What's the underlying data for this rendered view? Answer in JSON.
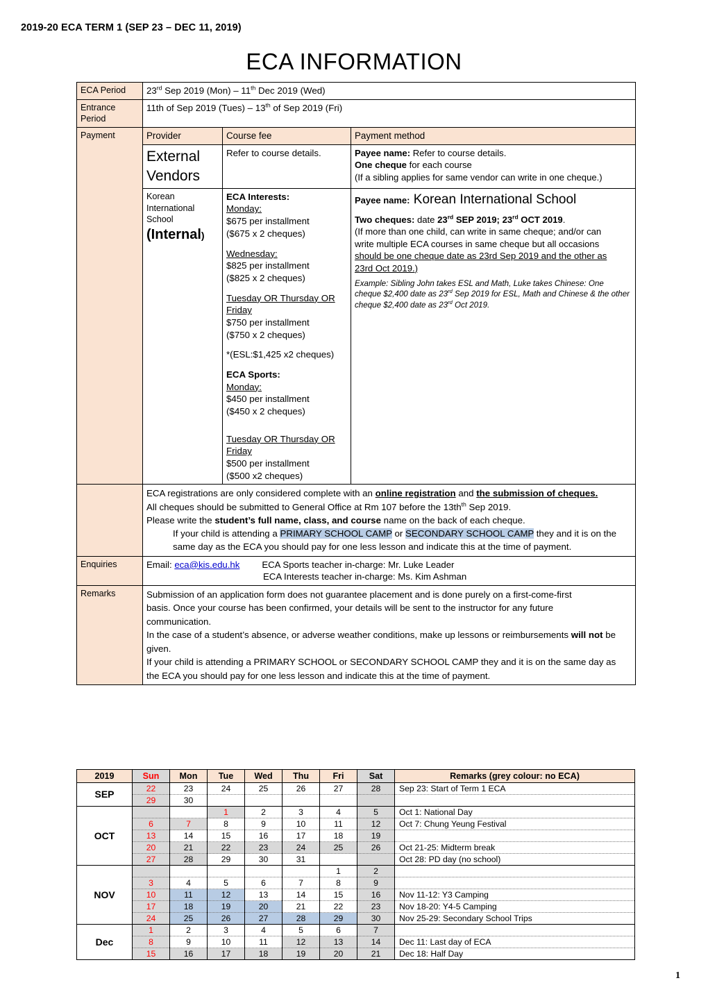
{
  "header": {
    "doc_header": "2019-20 ECA   TERM 1   (SEP 23 – DEC 11, 2019)",
    "title": "ECA  INFORMATION",
    "page_number": "1"
  },
  "info": {
    "eca_period_label": "ECA Period",
    "eca_period_value_pre": "23",
    "eca_period_value_sup1": "rd",
    "eca_period_value_mid": " Sep 2019 (Mon) – 11",
    "eca_period_value_sup2": "th",
    "eca_period_value_post": " Dec 2019 (Wed)",
    "entrance_label": "Entrance Period",
    "entrance_value_pre": "11th of Sep 2019 (Tues) – 13",
    "entrance_value_sup": "th",
    "entrance_value_post": " of Sep 2019 (Fri)",
    "payment_label": "Payment",
    "col_provider": "Provider",
    "col_course_fee": "Course fee",
    "col_payment_method": "Payment method"
  },
  "external": {
    "provider": "External Vendors",
    "provider_line1": "External",
    "provider_line2": "Vendors",
    "course_fee": "Refer to course details.",
    "payee_label": "Payee name:",
    "payee_value": " Refer to course details.",
    "one_cheque_bold": "One cheque",
    "one_cheque_rest": " for each course",
    "sibling_note": "(If a sibling applies for same vendor can write in one cheque.)"
  },
  "internal": {
    "provider_line1": "Korean",
    "provider_line2": "International",
    "provider_line3": "School",
    "provider_internal": "Internal",
    "fees": {
      "interests_title": "ECA Interests:",
      "interests": [
        {
          "day": "Monday:",
          "line1": "$675 per installment",
          "line2": "($675 x 2 cheques)"
        },
        {
          "day": "Wednesday:",
          "line1": "$825 per installment",
          "line2": "($825 x 2 cheques)"
        },
        {
          "day": "Tuesday OR Thursday OR Friday",
          "line1": "$750 per installment",
          "line2": "($750 x 2 cheques)"
        }
      ],
      "esl_note": "*(ESL:$1,425 x2 cheques)",
      "sports_title": "ECA Sports:",
      "sports": [
        {
          "day": "Monday:",
          "line1": "$450 per installment",
          "line2": "($450 x 2 cheques)"
        },
        {
          "day": "Tuesday OR Thursday OR Friday",
          "line1": "$500 per installment",
          "line2": "($500 x2 cheques)"
        }
      ]
    },
    "payment": {
      "payee_label": "Payee name:",
      "payee_value": " Korean International School",
      "two_cheques_label": "Two cheques:",
      "two_cheques_mid": " date ",
      "date1_pre": "23",
      "date1_sup": "rd",
      "date1_post": " SEP 2019; ",
      "date2_pre": "23",
      "date2_sup": "rd",
      "date2_post": " OCT 2019",
      "period": ".",
      "paren_line1": "(If more than one child, can write in same cheque; and/or can",
      "paren_line2": "write multiple ECA courses in same cheque but all occasions",
      "underlined1": "should be one cheque date as 23rd Sep 2019 and the other as",
      "underlined2": "23rd Oct 2019.)",
      "example_pre": "Example: Sibling John takes ESL and Math, Luke takes Chinese: One cheque $2,400 date as 23",
      "example_sup1": "rd",
      "example_mid": " Sep 2019 for ESL, Math and Chinese & the other cheque $2,400 date as 23",
      "example_sup2": "rd",
      "example_post": " Oct 2019."
    }
  },
  "registration_note": {
    "line1_a": "ECA registrations are only considered complete with an ",
    "line1_b": "online registration",
    "line1_c": " and ",
    "line1_d": "the submission of cheques.",
    "line2_a": "All cheques should be submitted to General Office at Rm 107 before the 13th",
    "line2_sup": "th",
    "line2_b": " Sep 2019.",
    "line3_a": "Please write the ",
    "line3_b": "student’s full name, class, and course",
    "line3_c": " name on the back of each cheque.",
    "line4_a": "If your child is attending a ",
    "line4_hl1": "PRIMARY SCHOOL CAMP",
    "line4_b": " or ",
    "line4_hl2": "SECONDARY SCHOOL CAMP",
    "line4_c": " they and it is on the",
    "line5": "same day as the ECA you should pay for one less lesson and indicate this at the time of payment."
  },
  "enquiries": {
    "label": "Enquiries",
    "email_prefix": "Email: ",
    "email": "eca@kis.edu.hk",
    "sports_teacher": "ECA Sports teacher in-charge: Mr. Luke Leader",
    "interests_teacher": "ECA Interests teacher in-charge: Ms. Kim Ashman"
  },
  "remarks": {
    "label": "Remarks",
    "p1_line1": "Submission of an application form does not guarantee placement and is done purely on a first-come-first",
    "p1_line2": "basis.  Once your course has been confirmed, your details will be sent to the instructor for any future",
    "p1_line3": "communication.",
    "p2_a": " In the case of a student’s absence, or adverse weather conditions, make up lessons or reimbursements ",
    "p2_b": "will not",
    "p2_c": " be given.",
    "p3_line1": "If your child is attending a PRIMARY SCHOOL or SECONDARY SCHOOL CAMP they and it is on the same day as",
    "p3_line2": "the ECA you should pay for one less lesson and indicate this at the time of payment."
  },
  "calendar": {
    "year_label": "2019",
    "day_headers": [
      "Sun",
      "Mon",
      "Tue",
      "Wed",
      "Thu",
      "Fri",
      "Sat"
    ],
    "remarks_header": "Remarks (grey colour: no ECA)",
    "months": [
      {
        "name": "SEP",
        "weeks": [
          {
            "days": [
              {
                "n": "22",
                "grey": true,
                "red": true
              },
              {
                "n": "23"
              },
              {
                "n": "24"
              },
              {
                "n": "25"
              },
              {
                "n": "26"
              },
              {
                "n": "27"
              },
              {
                "n": "28",
                "grey": true
              }
            ],
            "remark": "Sep 23: Start of Term 1 ECA"
          },
          {
            "days": [
              {
                "n": "29",
                "grey": true,
                "red": true
              },
              {
                "n": "30"
              },
              {
                "n": ""
              },
              {
                "n": ""
              },
              {
                "n": ""
              },
              {
                "n": ""
              },
              {
                "n": "",
                "grey": true
              }
            ],
            "remark": ""
          }
        ]
      },
      {
        "name": "OCT",
        "weeks": [
          {
            "days": [
              {
                "n": "",
                "grey": true
              },
              {
                "n": ""
              },
              {
                "n": "1",
                "grey": true,
                "red": true
              },
              {
                "n": "2"
              },
              {
                "n": "3"
              },
              {
                "n": "4"
              },
              {
                "n": "5",
                "grey": true
              }
            ],
            "remark": "Oct 1: National Day"
          },
          {
            "days": [
              {
                "n": "6",
                "grey": true,
                "red": true
              },
              {
                "n": "7",
                "grey": true,
                "red": true
              },
              {
                "n": "8"
              },
              {
                "n": "9"
              },
              {
                "n": "10"
              },
              {
                "n": "11"
              },
              {
                "n": "12",
                "grey": true
              }
            ],
            "remark": "Oct 7: Chung Yeung Festival"
          },
          {
            "days": [
              {
                "n": "13",
                "grey": true,
                "red": true
              },
              {
                "n": "14"
              },
              {
                "n": "15"
              },
              {
                "n": "16"
              },
              {
                "n": "17"
              },
              {
                "n": "18"
              },
              {
                "n": "19",
                "grey": true
              }
            ],
            "remark": ""
          },
          {
            "days": [
              {
                "n": "20",
                "grey": true,
                "red": true
              },
              {
                "n": "21",
                "grey": true
              },
              {
                "n": "22",
                "grey": true
              },
              {
                "n": "23",
                "grey": true
              },
              {
                "n": "24",
                "grey": true
              },
              {
                "n": "25",
                "grey": true
              },
              {
                "n": "26",
                "grey": true
              }
            ],
            "remark": "Oct 21-25: Midterm break"
          },
          {
            "days": [
              {
                "n": "27",
                "grey": true,
                "red": true
              },
              {
                "n": "28",
                "grey": true
              },
              {
                "n": "29"
              },
              {
                "n": "30"
              },
              {
                "n": "31"
              },
              {
                "n": ""
              },
              {
                "n": "",
                "grey": true
              }
            ],
            "remark": "Oct 28: PD day (no school)"
          }
        ]
      },
      {
        "name": "NOV",
        "weeks": [
          {
            "days": [
              {
                "n": "",
                "grey": true
              },
              {
                "n": ""
              },
              {
                "n": ""
              },
              {
                "n": ""
              },
              {
                "n": ""
              },
              {
                "n": "1"
              },
              {
                "n": "2",
                "grey": true
              }
            ],
            "remark": ""
          },
          {
            "days": [
              {
                "n": "3",
                "grey": true,
                "red": true
              },
              {
                "n": "4"
              },
              {
                "n": "5"
              },
              {
                "n": "6"
              },
              {
                "n": "7"
              },
              {
                "n": "8"
              },
              {
                "n": "9",
                "grey": true
              }
            ],
            "remark": ""
          },
          {
            "days": [
              {
                "n": "10",
                "grey": true,
                "red": true
              },
              {
                "n": "11",
                "blue": true
              },
              {
                "n": "12",
                "blue": true
              },
              {
                "n": "13"
              },
              {
                "n": "14"
              },
              {
                "n": "15"
              },
              {
                "n": "16",
                "grey": true
              }
            ],
            "remark": "Nov 11-12: Y3 Camping"
          },
          {
            "days": [
              {
                "n": "17",
                "grey": true,
                "red": true
              },
              {
                "n": "18",
                "blue": true
              },
              {
                "n": "19",
                "blue": true
              },
              {
                "n": "20",
                "blue": true
              },
              {
                "n": "21"
              },
              {
                "n": "22"
              },
              {
                "n": "23",
                "grey": true
              }
            ],
            "remark": "Nov 18-20: Y4-5 Camping"
          },
          {
            "days": [
              {
                "n": "24",
                "grey": true,
                "red": true
              },
              {
                "n": "25",
                "blue": true
              },
              {
                "n": "26",
                "blue": true
              },
              {
                "n": "27",
                "blue": true
              },
              {
                "n": "28",
                "blue": true
              },
              {
                "n": "29",
                "blue": true
              },
              {
                "n": "30",
                "grey": true
              }
            ],
            "remark": "Nov 25-29: Secondary School Trips"
          }
        ]
      },
      {
        "name": "Dec",
        "weeks": [
          {
            "days": [
              {
                "n": "1",
                "grey": true,
                "red": true
              },
              {
                "n": "2"
              },
              {
                "n": "3"
              },
              {
                "n": "4"
              },
              {
                "n": "5"
              },
              {
                "n": "6"
              },
              {
                "n": "7",
                "grey": true
              }
            ],
            "remark": ""
          },
          {
            "days": [
              {
                "n": "8",
                "grey": true,
                "red": true
              },
              {
                "n": "9"
              },
              {
                "n": "10"
              },
              {
                "n": "11"
              },
              {
                "n": "12",
                "grey": true
              },
              {
                "n": "13",
                "grey": true
              },
              {
                "n": "14",
                "grey": true
              }
            ],
            "remark": "Dec 11: Last day of ECA"
          },
          {
            "days": [
              {
                "n": "15",
                "grey": true,
                "red": true
              },
              {
                "n": "16",
                "grey": true
              },
              {
                "n": "17",
                "grey": true
              },
              {
                "n": "18",
                "grey": true
              },
              {
                "n": "19",
                "grey": true
              },
              {
                "n": "20",
                "grey": true
              },
              {
                "n": "21",
                "grey": true
              }
            ],
            "remark": "Dec 18: Half Day"
          }
        ]
      }
    ]
  },
  "colors": {
    "peach": "#fae3d2",
    "grey": "#d9d9d9",
    "blue": "#b8cce4",
    "red": "#ff0000"
  }
}
